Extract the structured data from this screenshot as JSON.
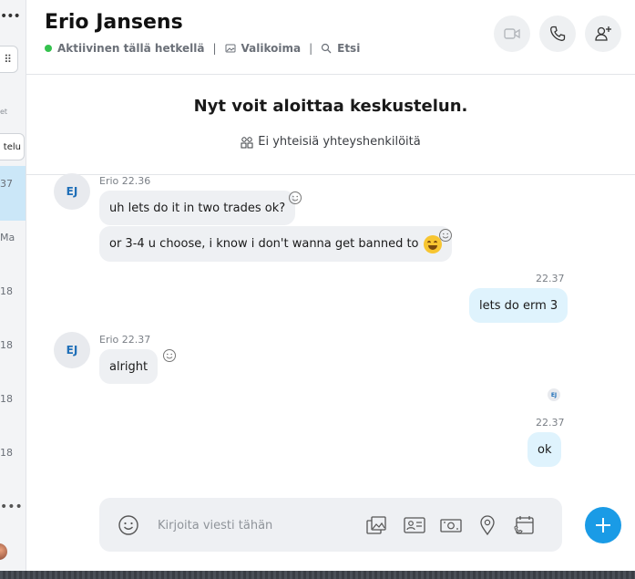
{
  "sidebar": {
    "more_glyph": "•••",
    "dialpad_glyph": "⠿",
    "label_partial": "et",
    "tab_partial": "telu",
    "times": [
      "37",
      "Ma",
      "18",
      "18",
      "18",
      "18"
    ],
    "more_glyph_bottom": "•••"
  },
  "header": {
    "contact_name": "Erio Jansens",
    "status_text": "Aktiivinen tällä hetkellä",
    "gallery_label": "Valikoima",
    "search_label": "Etsi",
    "separator": "|",
    "status_color": "#35c24e",
    "buttons": [
      "video-call",
      "audio-call",
      "add-person"
    ]
  },
  "intro": {
    "title": "Nyt voit aloittaa keskustelun.",
    "subtitle": "Ei yhteisiä yhteyshenkilöitä"
  },
  "messages": {
    "m1": {
      "sender": "Erio",
      "time": "22.36",
      "avatar": "EJ",
      "text": "uh lets do it in two trades ok?"
    },
    "m2": {
      "text": "or 3-4 u choose, i know i don't wanna get banned to"
    },
    "m3": {
      "time": "22.37",
      "text": "lets do erm 3"
    },
    "m4": {
      "sender": "Erio",
      "time": "22.37",
      "avatar": "EJ",
      "text": "alright"
    },
    "read_receipt": "EJ",
    "m5": {
      "time": "22.37",
      "text": "ok"
    }
  },
  "composer": {
    "placeholder": "Kirjoita viesti tähän",
    "accent": "#1a9be6"
  }
}
